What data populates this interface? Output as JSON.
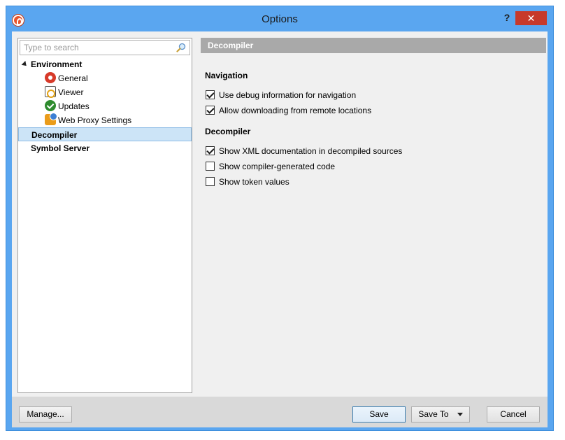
{
  "window": {
    "title": "Options",
    "help_label": "?",
    "close_label": "✕"
  },
  "search": {
    "placeholder": "Type to search"
  },
  "tree": {
    "environment": "Environment",
    "children": [
      "General",
      "Viewer",
      "Updates",
      "Web Proxy Settings"
    ],
    "decompiler": "Decompiler",
    "symbol_server": "Symbol Server"
  },
  "panel": {
    "header": "Decompiler",
    "navigation_title": "Navigation",
    "nav_use_debug": "Use debug information for navigation",
    "nav_allow_download": "Allow downloading from remote locations",
    "decompiler_title": "Decompiler",
    "show_xml_docs": "Show XML documentation in decompiled sources",
    "show_compiler_code": "Show compiler-generated code",
    "show_token_values": "Show token values"
  },
  "buttons": {
    "manage": "Manage...",
    "save": "Save",
    "save_to": "Save To",
    "cancel": "Cancel"
  },
  "colors": {
    "window_frame": "#5aa6f0",
    "close": "#c7392b",
    "selection": "#cce4f7",
    "section_header": "#a9a9a9"
  }
}
